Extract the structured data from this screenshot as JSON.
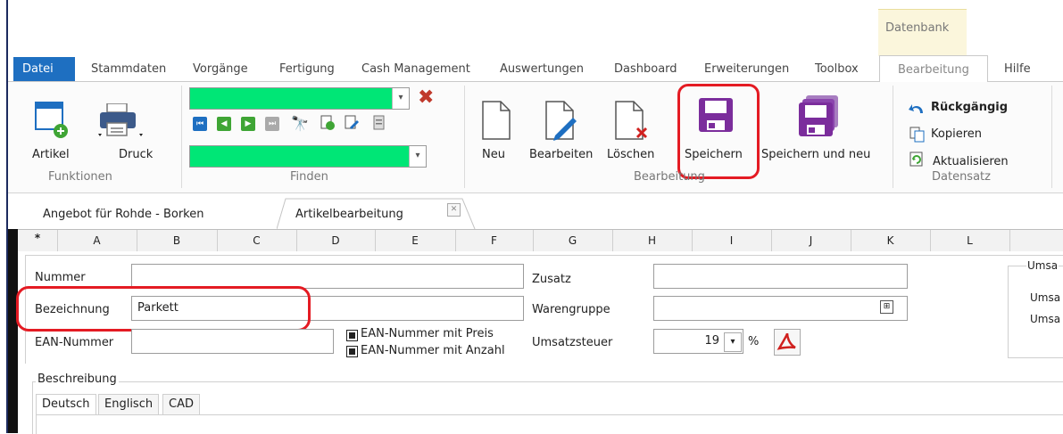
{
  "window": {
    "context_tab": "Datenbank"
  },
  "menu": {
    "datei": "Datei",
    "items": [
      "Stammdaten",
      "Vorgänge",
      "Fertigung",
      "Cash Management",
      "Auswertungen",
      "Dashboard",
      "Erweiterungen",
      "Toolbox",
      "Bearbeitung",
      "Hilfe"
    ],
    "active": "Bearbeitung"
  },
  "ribbon": {
    "funktionen": {
      "label": "Funktionen",
      "artikel": "Artikel",
      "druck": "Druck"
    },
    "finden": {
      "label": "Finden"
    },
    "bearbeitung": {
      "label": "Bearbeitung",
      "neu": "Neu",
      "bearbeiten": "Bearbeiten",
      "loeschen": "Löschen",
      "speichern": "Speichern",
      "speichern_neu": "Speichern und neu"
    },
    "datensatz": {
      "label": "Datensatz",
      "rueckgaengig": "Rückgängig",
      "kopieren": "Kopieren",
      "aktualisieren": "Aktualisieren"
    }
  },
  "doc_tabs": [
    {
      "label": "Angebot für Rohde - Borken"
    },
    {
      "label": "Artikelbearbeitung"
    }
  ],
  "grid": {
    "corner": "*",
    "columns": [
      "A",
      "B",
      "C",
      "D",
      "E",
      "F",
      "G",
      "H",
      "I",
      "J",
      "K",
      "L"
    ]
  },
  "form": {
    "nummer": {
      "label": "Nummer",
      "value": ""
    },
    "bezeichnung": {
      "label": "Bezeichnung",
      "value": "Parkett"
    },
    "ean": {
      "label": "EAN-Nummer",
      "value": ""
    },
    "ean_preis": "EAN-Nummer mit Preis",
    "ean_anzahl": "EAN-Nummer mit Anzahl",
    "zusatz": {
      "label": "Zusatz",
      "value": ""
    },
    "warengruppe": {
      "label": "Warengruppe",
      "value": ""
    },
    "umsatzsteuer": {
      "label": "Umsatzsteuer",
      "value": "19",
      "unit": "%"
    },
    "right_group": {
      "title": "Umsa",
      "line1": "Umsa",
      "line2": "Umsa"
    },
    "beschreibung": "Beschreibung",
    "lang_tabs": [
      "Deutsch",
      "Englisch",
      "CAD"
    ]
  },
  "colors": {
    "accent": "#1e6fc1",
    "highlight": "#e41b23",
    "finder_green": "#00e676",
    "save_purple": "#7b2d9c"
  }
}
